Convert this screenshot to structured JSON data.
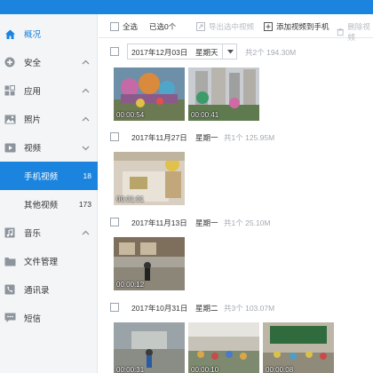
{
  "sidebar": {
    "items": [
      {
        "label": "概况",
        "icon": "home-icon"
      },
      {
        "label": "安全",
        "icon": "shield-plus-icon"
      },
      {
        "label": "应用",
        "icon": "apps-grid-icon"
      },
      {
        "label": "照片",
        "icon": "photo-icon"
      },
      {
        "label": "视频",
        "icon": "video-icon"
      },
      {
        "label": "手机视频",
        "count": "18"
      },
      {
        "label": "其他视频",
        "count": "173"
      },
      {
        "label": "音乐",
        "icon": "music-icon"
      },
      {
        "label": "文件管理",
        "icon": "folder-icon"
      },
      {
        "label": "通讯录",
        "icon": "phone-icon"
      },
      {
        "label": "短信",
        "icon": "sms-icon"
      }
    ]
  },
  "toolbar": {
    "select_all": "全选",
    "selected": "已选0个",
    "export": "导出选中视频",
    "add": "添加视频到手机",
    "delete": "删除视频"
  },
  "groups": [
    {
      "date": "2017年12月03日",
      "day": "星期天",
      "summary": "共2个 194.30M",
      "durations": [
        "00:00:54",
        "00:00:41"
      ]
    },
    {
      "date": "2017年11月27日",
      "day": "星期一",
      "summary": "共1个 125.95M",
      "durations": [
        "00:01:01"
      ]
    },
    {
      "date": "2017年11月13日",
      "day": "星期一",
      "summary": "共1个 25.10M",
      "durations": [
        "00:00:12"
      ]
    },
    {
      "date": "2017年10月31日",
      "day": "星期二",
      "summary": "共3个 103.07M",
      "durations": [
        "00:00:31",
        "00:00:10",
        "00:00:08"
      ]
    }
  ],
  "colors": {
    "accent": "#1a84de",
    "sidebar_bg": "#f4f5f7"
  }
}
